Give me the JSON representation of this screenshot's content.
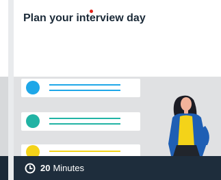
{
  "card": {
    "title": "Plan your interview day",
    "duration_value": "20",
    "duration_unit": "Minutes"
  },
  "icons": {
    "clock": "clock-icon"
  },
  "colors": {
    "footer_bg": "#1e2d3c",
    "title_text": "#1b2a38",
    "accent_blue": "#1ea7e8",
    "accent_teal": "#21b3a4",
    "accent_yellow": "#f4d319",
    "red_dot": "#e2231a"
  }
}
